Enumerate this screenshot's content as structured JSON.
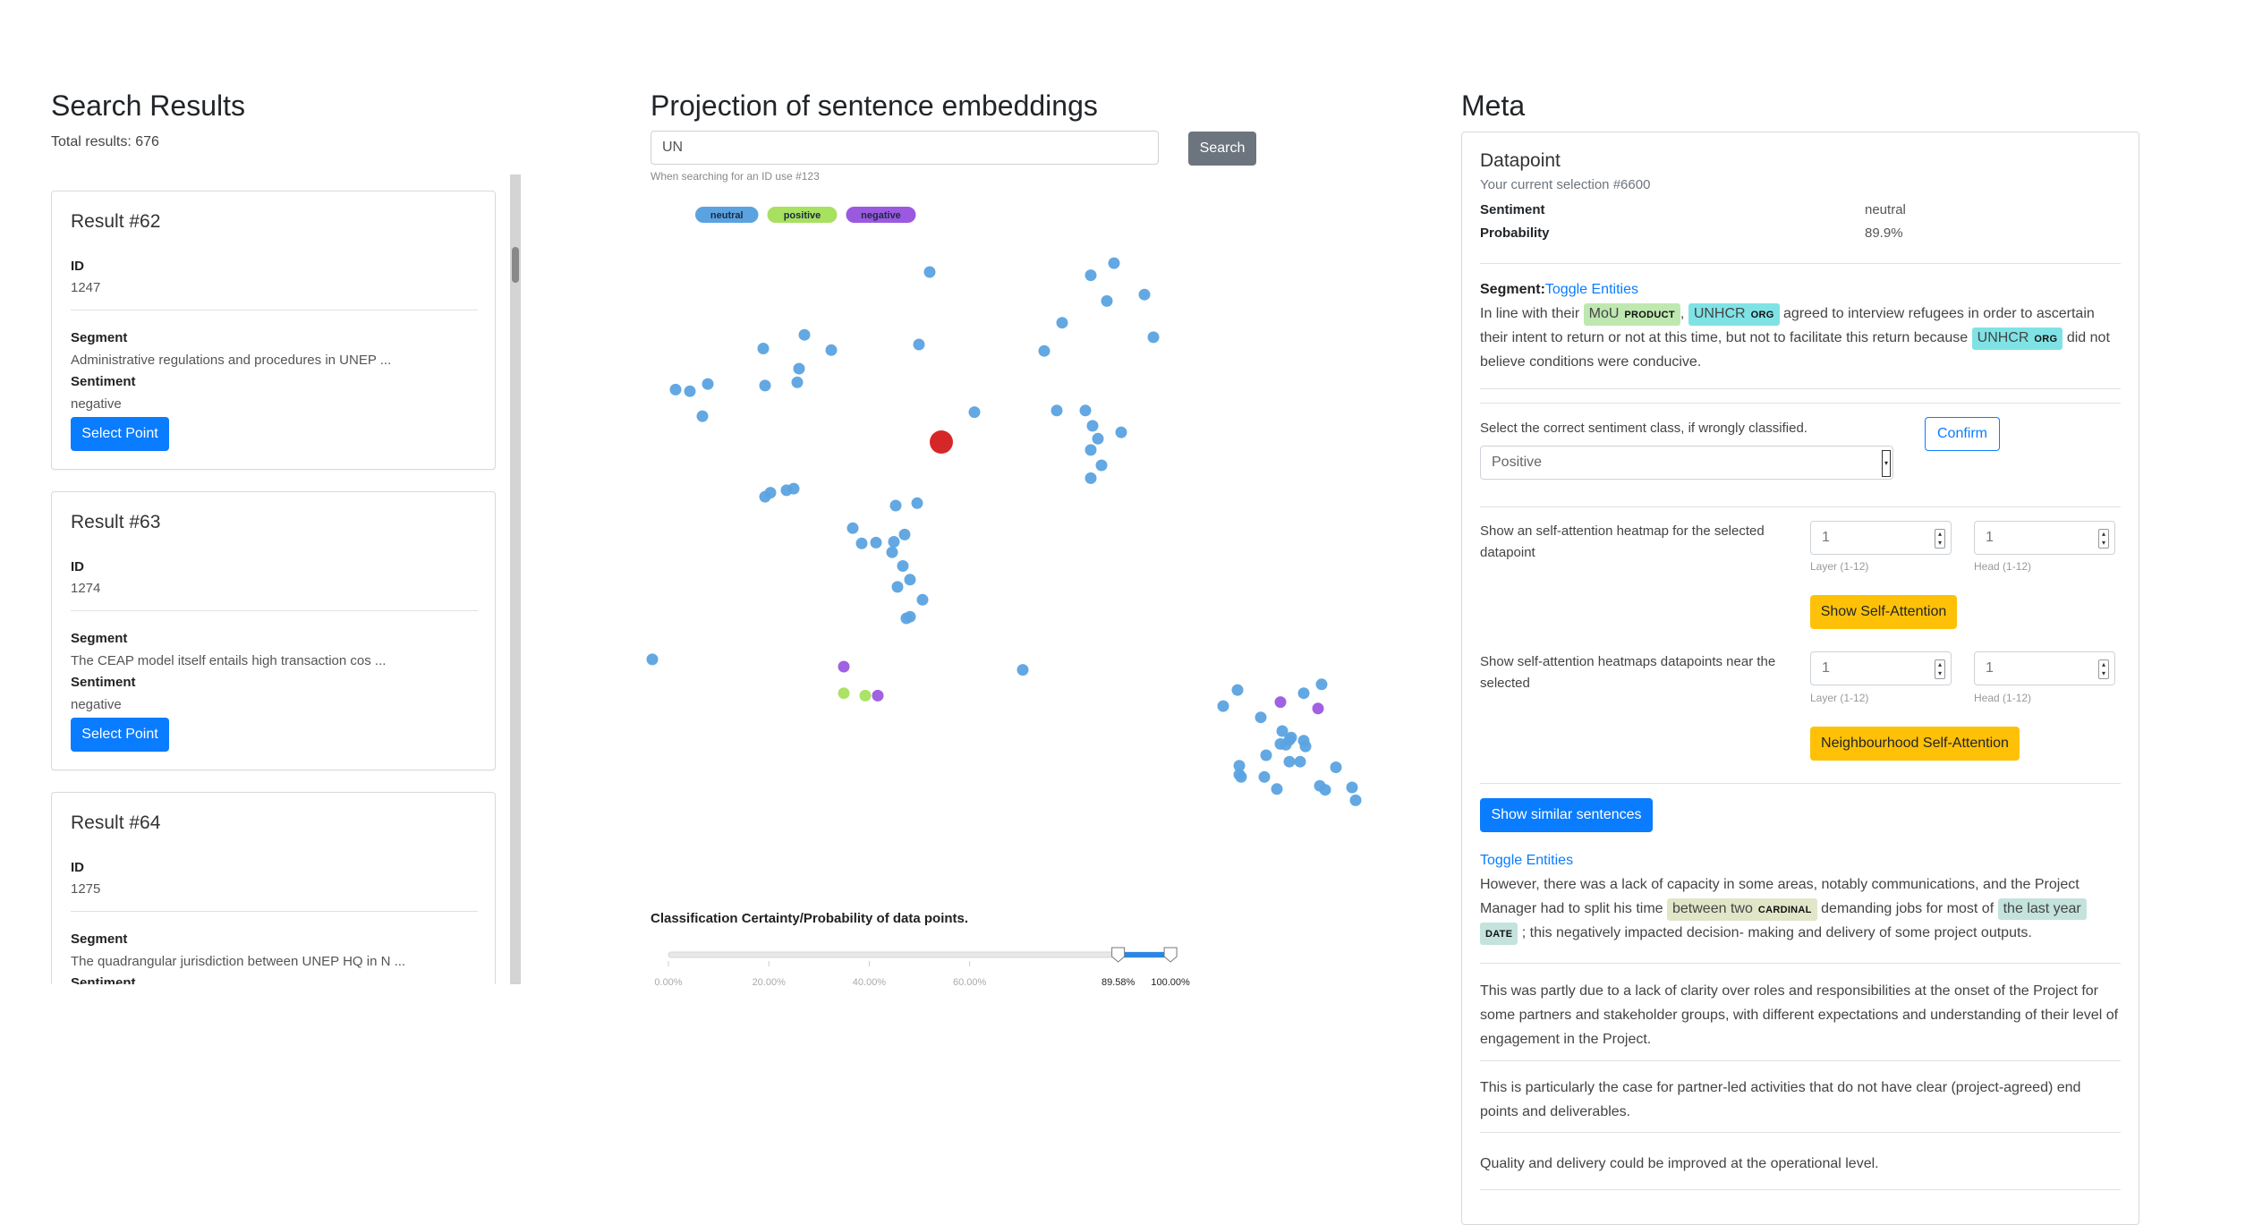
{
  "search_results": {
    "title": "Search Results",
    "total": "Total results: 676",
    "id_label": "ID",
    "segment_label": "Segment",
    "sentiment_label": "Sentiment",
    "select_button": "Select Point",
    "results": [
      {
        "title": "Result #62",
        "id": "1247",
        "segment": "Administrative regulations and procedures in UNEP ...",
        "sentiment": "negative"
      },
      {
        "title": "Result #63",
        "id": "1274",
        "segment": "The CEAP model itself entails high transaction cos ...",
        "sentiment": "negative"
      },
      {
        "title": "Result #64",
        "id": "1275",
        "segment": "The quadrangular jurisdiction between UNEP HQ in N ...",
        "sentiment": ""
      }
    ]
  },
  "projection": {
    "title": "Projection of sentence embeddings",
    "search_value": "UN",
    "search_button": "Search",
    "search_hint": "When searching for an ID use #123",
    "legend": [
      {
        "label": "neutral",
        "color": "#5ba3e0"
      },
      {
        "label": "positive",
        "color": "#a8e05f"
      },
      {
        "label": "negative",
        "color": "#9b59e0"
      }
    ],
    "certainty_label": "Classification Certainty/Probability of data points.",
    "slider": {
      "ticks": [
        "0.00%",
        "20.00%",
        "40.00%",
        "60.00%"
      ],
      "low": "89.58%",
      "high": "100.00%",
      "low_value": 0.8958,
      "high_value": 1.0
    }
  },
  "chart_data": {
    "type": "scatter",
    "title": "",
    "xlabel": "",
    "ylabel": "",
    "series": [
      {
        "name": "neutral",
        "color": "#5ba3e0",
        "points": [
          [
            156,
            40
          ],
          [
            259,
            29
          ],
          [
            246,
            44
          ],
          [
            230,
            103
          ],
          [
            255,
            76
          ],
          [
            220,
            138
          ],
          [
            276,
            68
          ],
          [
            281,
            121
          ],
          [
            63,
            135
          ],
          [
            101,
            137
          ],
          [
            83,
            160
          ],
          [
            82,
            177
          ],
          [
            32,
            179
          ],
          [
            22,
            188
          ],
          [
            64,
            181
          ],
          [
            14,
            186
          ],
          [
            29,
            219
          ],
          [
            86,
            118
          ],
          [
            150,
            130
          ],
          [
            181,
            214
          ],
          [
            227,
            212
          ],
          [
            243,
            212
          ],
          [
            247,
            231
          ],
          [
            263,
            239
          ],
          [
            250,
            247
          ],
          [
            246,
            261
          ],
          [
            252,
            280
          ],
          [
            246,
            296
          ],
          [
            80,
            309
          ],
          [
            76,
            311
          ],
          [
            67,
            314
          ],
          [
            64,
            319
          ],
          [
            149,
            327
          ],
          [
            137,
            330
          ],
          [
            113,
            358
          ],
          [
            142,
            366
          ],
          [
            136,
            375
          ],
          [
            118,
            377
          ],
          [
            126,
            376
          ],
          [
            135,
            388
          ],
          [
            141,
            405
          ],
          [
            145,
            422
          ],
          [
            138,
            431
          ],
          [
            152,
            447
          ],
          [
            145,
            468
          ],
          [
            143,
            470
          ],
          [
            1,
            521
          ],
          [
            208,
            534
          ],
          [
            328,
            559
          ],
          [
            320,
            579
          ],
          [
            365,
            563
          ],
          [
            375,
            552
          ],
          [
            358,
            618
          ],
          [
            353,
            610
          ],
          [
            343,
            667
          ],
          [
            350,
            682
          ],
          [
            357,
            648
          ],
          [
            365,
            622
          ],
          [
            341,
            593
          ],
          [
            357,
            621
          ],
          [
            352,
            626
          ],
          [
            355,
            627
          ],
          [
            366,
            629
          ],
          [
            383,
            655
          ],
          [
            374,
            678
          ],
          [
            377,
            683
          ],
          [
            344,
            640
          ],
          [
            363,
            648
          ],
          [
            394,
            696
          ],
          [
            392,
            680
          ],
          [
            329,
            653
          ],
          [
            329,
            664
          ],
          [
            330,
            667
          ]
        ]
      },
      {
        "name": "positive",
        "color": "#a8e05f",
        "points": [
          [
            108,
            563
          ],
          [
            120,
            566
          ]
        ]
      },
      {
        "name": "negative",
        "color": "#9b59e0",
        "points": [
          [
            108,
            530
          ],
          [
            127,
            566
          ],
          [
            352,
            574
          ],
          [
            373,
            582
          ]
        ]
      }
    ],
    "selected_point": {
      "label": "selected",
      "color": "#d62728"
    }
  },
  "meta": {
    "title": "Meta",
    "datapoint_title": "Datapoint",
    "selection": "Your current selection #6600",
    "sentiment_label": "Sentiment",
    "sentiment_value": "neutral",
    "probability_label": "Probability",
    "probability_value": "89.9%",
    "segment_label": "Segment:",
    "toggle_entities": "Toggle Entities",
    "segment_text": {
      "t1": "In line with their",
      "e1": "MoU",
      "e1_tag": "PRODUCT",
      "t2": ",",
      "e2": "UNHCR",
      "e2_tag": "ORG",
      "t3": "agreed to interview refugees in order to ascertain their intent to return or not at this time, but not to facilitate this return because",
      "e3": "UNHCR",
      "e3_tag": "ORG",
      "t4": "did not believe conditions were conducive."
    },
    "select_correct": "Select the correct sentiment class, if wrongly classified.",
    "confirm_button": "Confirm",
    "sentiment_select": "Positive",
    "self_attention_label": "Show an self-attention heatmap for the selected datapoint",
    "layer_value": "1",
    "head_value": "1",
    "layer_hint": "Layer (1-12)",
    "head_hint": "Head (1-12)",
    "show_self_attention": "Show Self-Attention",
    "neigh_label": "Show self-attention heatmaps datapoints near the selected",
    "neigh_layer_value": "1",
    "neigh_head_value": "1",
    "neigh_button": "Neighbourhood Self-Attention",
    "similar_button": "Show similar sentences",
    "similar_toggle": "Toggle Entities",
    "similar": {
      "s1_t1": "However, there was a lack of capacity in some areas, notably communications, and the Project Manager had to split his time",
      "s1_e1": "between two",
      "s1_e1_tag": "CARDINAL",
      "s1_t2": "demanding jobs for most of",
      "s1_e2": "the last year",
      "s1_e2_tag": "DATE",
      "s1_t3": "; this negatively impacted decision- making and delivery of some project outputs.",
      "s2": "This was partly due to a lack of clarity over roles and responsibilities at the onset of the Project for some partners and stakeholder groups, with different expectations and understanding of their level of engagement in the Project.",
      "s3": "This is particularly the case for partner-led activities that do not have clear (project-agreed) end points and deliverables.",
      "s4": "Quality and delivery could be improved at the operational level."
    }
  }
}
